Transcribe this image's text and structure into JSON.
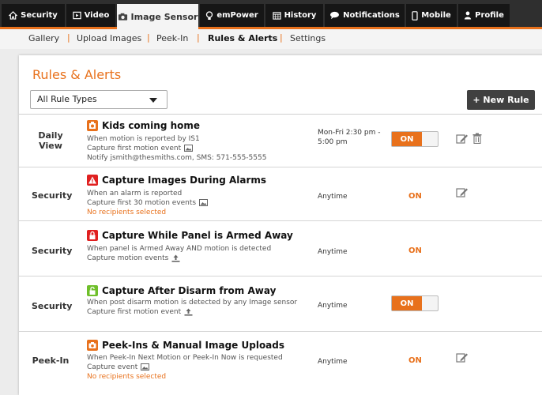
{
  "nav": {
    "tabs": [
      {
        "label": "Security",
        "icon": "home-icon"
      },
      {
        "label": "Video",
        "icon": "video-icon"
      },
      {
        "label": "Image Sensor",
        "icon": "camera-icon"
      },
      {
        "label": "emPower",
        "icon": "lightbulb-icon"
      },
      {
        "label": "History",
        "icon": "calendar-icon"
      },
      {
        "label": "Notifications",
        "icon": "chat-bubble-icon"
      },
      {
        "label": "Mobile",
        "icon": "phone-icon"
      },
      {
        "label": "Profile",
        "icon": "person-icon"
      }
    ],
    "active_tab": "Image Sensor",
    "subtabs": [
      "Gallery",
      "Upload Images",
      "Peek-In",
      "Rules & Alerts",
      "Settings"
    ],
    "active_subtab": "Rules & Alerts",
    "separator": "|"
  },
  "page": {
    "title": "Rules & Alerts",
    "filter": {
      "selected": "All Rule Types"
    },
    "new_rule_label": "+ New Rule"
  },
  "colors": {
    "accent": "#e8711c",
    "nav_bg": "#161616",
    "alarm_red": "#e02020",
    "green": "#6fbf2a"
  },
  "rules": [
    {
      "type": "Daily View",
      "title": "Kids coming home",
      "icon": "clock-icon",
      "desc1": "When motion is reported by IS1",
      "desc2": "Capture first motion event",
      "desc3": "Notify jsmith@thesmiths.com, SMS: 571-555-5555",
      "when": "Mon-Fri 2:30 pm - 5:00 pm",
      "status": "ON",
      "toggle": true,
      "editable": true,
      "deletable": true
    },
    {
      "type": "Security",
      "title": "Capture Images During Alarms",
      "icon": "alarm-warning-icon",
      "desc1": "When an alarm is reported",
      "desc2": "Capture first 30 motion events",
      "desc3": "No recipients selected",
      "when": "Anytime",
      "status": "ON",
      "toggle": false,
      "editable": true,
      "deletable": false
    },
    {
      "type": "Security",
      "title": "Capture While Panel is Armed Away",
      "icon": "lock-closed-icon",
      "desc1": "When panel is Armed Away AND motion is detected",
      "desc2": "Capture motion events",
      "when": "Anytime",
      "status": "ON",
      "toggle": false,
      "editable": false,
      "deletable": false
    },
    {
      "type": "Security",
      "title": "Capture After Disarm from Away",
      "icon": "lock-open-icon",
      "desc1": "When post disarm motion is detected by any Image sensor",
      "desc2": "Capture first motion event",
      "when": "Anytime",
      "status": "ON",
      "toggle": true,
      "editable": false,
      "deletable": false
    },
    {
      "type": "Peek-In",
      "title": "Peek-Ins & Manual Image Uploads",
      "icon": "camera-icon",
      "desc1": "When Peek-In Next Motion or Peek-In Now is requested",
      "desc2": "Capture event",
      "desc3": "No recipients selected",
      "when": "Anytime",
      "status": "ON",
      "toggle": false,
      "editable": true,
      "deletable": false
    }
  ]
}
